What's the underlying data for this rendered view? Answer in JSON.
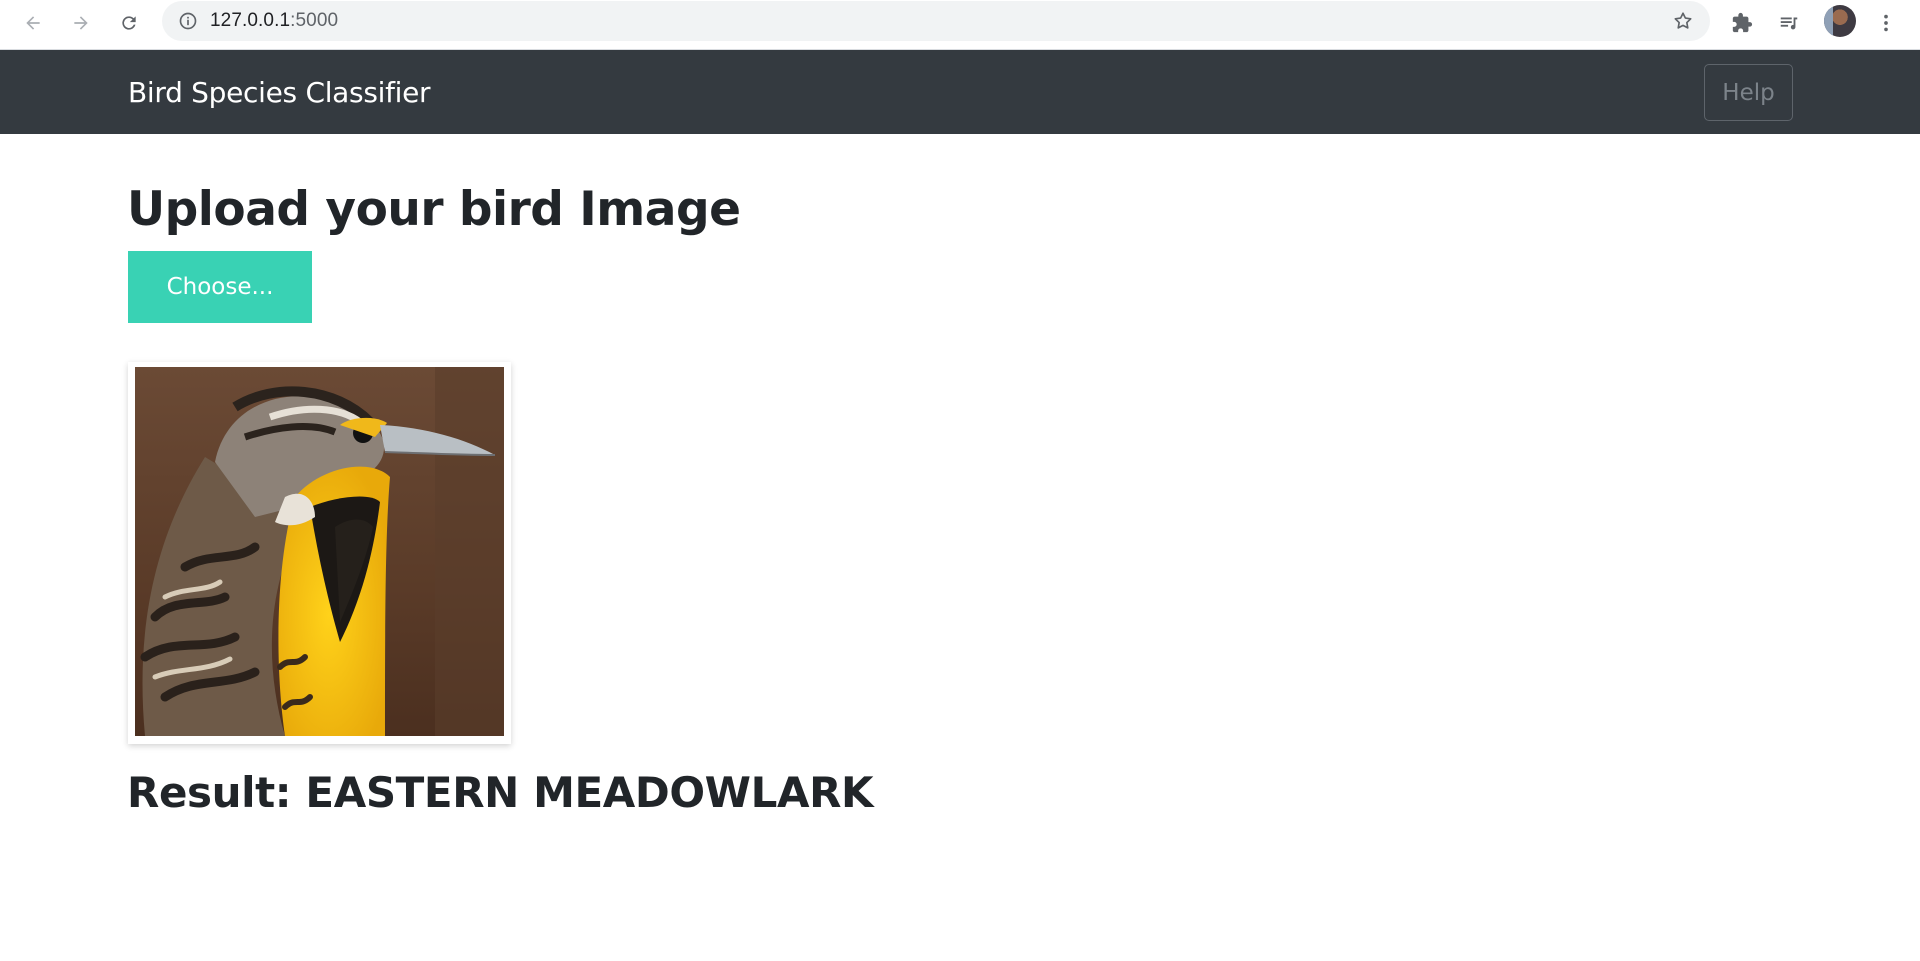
{
  "browser": {
    "url_host": "127.0.0.1",
    "url_port": ":5000",
    "icons": [
      "back-arrow-icon",
      "forward-arrow-icon",
      "reload-icon",
      "site-info-icon",
      "bookmark-star-icon",
      "extensions-icon",
      "media-queue-icon",
      "profile-avatar",
      "kebab-menu-icon"
    ]
  },
  "navbar": {
    "brand": "Bird Species Classifier",
    "help_label": "Help",
    "background": "#343a40"
  },
  "main": {
    "heading": "Upload your bird Image",
    "choose_label": "Choose...",
    "choose_color": "#39d2b4",
    "result_text": "Result: EASTERN MEADOWLARK"
  }
}
